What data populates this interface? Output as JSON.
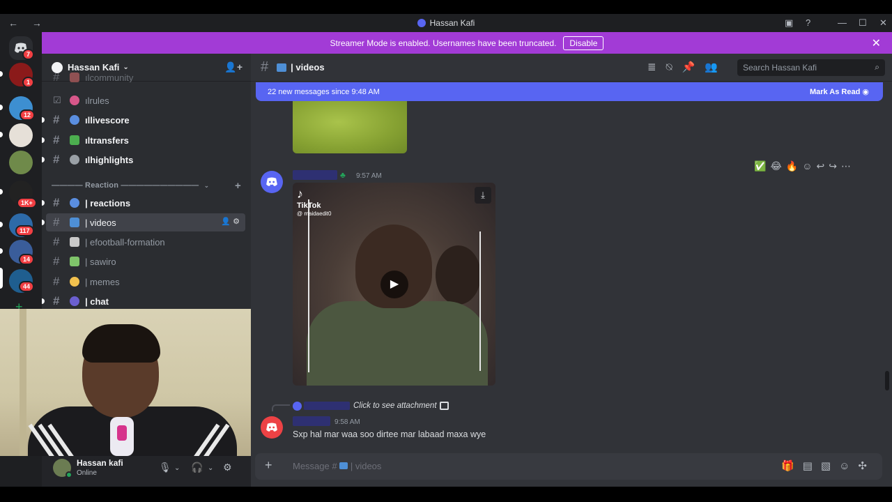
{
  "window": {
    "title": "Hassan Kafi",
    "nav_back": "←",
    "nav_forward": "→",
    "controls": [
      "—",
      "☐",
      "✕"
    ]
  },
  "banner": {
    "text": "Streamer Mode is enabled. Usernames have been truncated.",
    "button": "Disable"
  },
  "rail": {
    "badges": [
      "7",
      "1",
      "12",
      "1K+",
      "117",
      "14",
      "44"
    ]
  },
  "sidebar": {
    "server_name": "Hassan Kafi",
    "channels_top": [
      {
        "name": "community",
        "prefix": "ıl "
      },
      {
        "name": "rules",
        "prefix": "ıl "
      },
      {
        "name": "livescore",
        "prefix": "ıl "
      },
      {
        "name": "transfers",
        "prefix": "ıl "
      },
      {
        "name": "highlights",
        "prefix": "ıl "
      }
    ],
    "category": "———— Reaction ——————————",
    "channels": [
      {
        "name": "| reactions"
      },
      {
        "name": "| videos"
      },
      {
        "name": "| efootball-formation"
      },
      {
        "name": "| sawiro"
      },
      {
        "name": "| memes"
      },
      {
        "name": "| chat"
      }
    ]
  },
  "user": {
    "name": "Hassan kafi",
    "status": "Online"
  },
  "chat": {
    "channel": "| videos",
    "search_placeholder": "Search Hassan Kafi",
    "new_messages": "22 new messages since 9:48 AM",
    "mark_as_read": "Mark As Read",
    "messages": [
      {
        "time": "9:57 AM",
        "tiktok_brand": "TikTok",
        "tiktok_user": "@ maidaedit0"
      },
      {
        "reply_preview": "Click to see attachment",
        "time": "9:58 AM",
        "text": "Sxp hal mar waa soo dirtee mar labaad maxa wye"
      }
    ],
    "composer_placeholder": "Message #",
    "composer_channel": "| videos"
  },
  "colors": {
    "banner": "#a23bd6",
    "new_messages_bar": "#5865f2",
    "streamer_name": "#2a2be0"
  }
}
